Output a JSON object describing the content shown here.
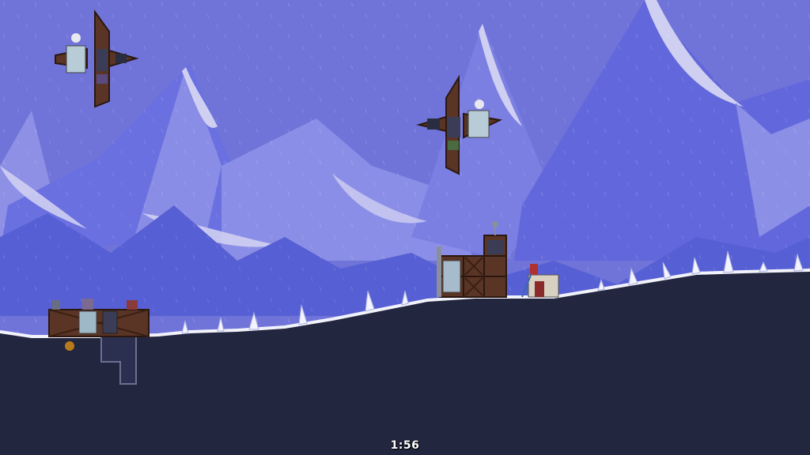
{
  "hud": {
    "match_timer": "1:56"
  },
  "scene": {
    "sky_color": "#6d71d8",
    "mountain_far_color": "#8e90e6",
    "mountain_near_color": "#5a63d4",
    "snow_cap_color": "#cfcff2",
    "ground_color": "#22263f",
    "ground_edge_color": "#f2f2fa",
    "wood_color": "#5a3424",
    "metal_color": "#8a8f99"
  }
}
